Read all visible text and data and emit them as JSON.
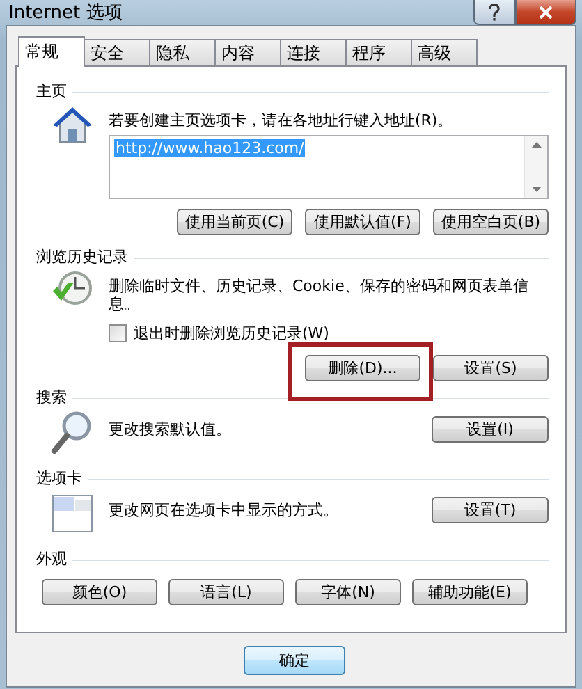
{
  "window": {
    "title": "Internet 选项"
  },
  "tabs": [
    {
      "label": "常规",
      "selected": true
    },
    {
      "label": "安全",
      "selected": false
    },
    {
      "label": "隐私",
      "selected": false
    },
    {
      "label": "内容",
      "selected": false
    },
    {
      "label": "连接",
      "selected": false
    },
    {
      "label": "程序",
      "selected": false
    },
    {
      "label": "高级",
      "selected": false
    }
  ],
  "home_page": {
    "title": "主页",
    "description": "若要创建主页选项卡，请在各地址行键入地址(R)。",
    "url": "http://www.hao123.com/",
    "url_selected": true,
    "buttons": [
      {
        "label": "使用当前页(C)"
      },
      {
        "label": "使用默认值(F)"
      },
      {
        "label": "使用空白页(B)"
      }
    ]
  },
  "browsing_history": {
    "title": "浏览历史记录",
    "description": "删除临时文件、历史记录、Cookie、保存的密码和网页表单信息。",
    "checkbox": {
      "label": "退出时删除浏览历史记录(W)",
      "checked": false
    },
    "buttons": [
      {
        "label": "删除(D)...",
        "highlighted": true
      },
      {
        "label": "设置(S)",
        "highlighted": false
      }
    ]
  },
  "search": {
    "title": "搜索",
    "description": "更改搜索默认值。",
    "button": "设置(I)"
  },
  "tabs_section": {
    "title": "选项卡",
    "description": "更改网页在选项卡中显示的方式。",
    "button": "设置(T)"
  },
  "appearance": {
    "title": "外观",
    "buttons": [
      {
        "label": "颜色(O)"
      },
      {
        "label": "语言(L)"
      },
      {
        "label": "字体(N)"
      },
      {
        "label": "辅助功能(E)"
      }
    ]
  },
  "footer": {
    "buttons": [
      {
        "label": "确定",
        "default": true
      }
    ]
  }
}
